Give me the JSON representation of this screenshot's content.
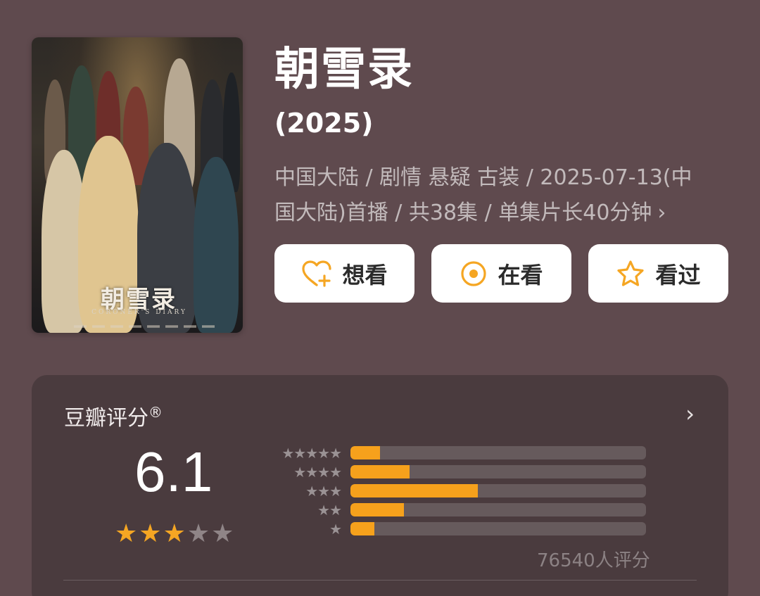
{
  "poster": {
    "logo_text": "朝雪录",
    "subtitle": "CORONER'S DIARY"
  },
  "title": "朝雪录",
  "year": "(2025)",
  "meta": {
    "line1": "中国大陆 / 剧情 悬疑 古装 / 2025-07-13(中",
    "line2": "国大陆)首播 / 共38集 / 单集片长40分钟",
    "chevron": "›"
  },
  "actions": [
    {
      "label": "想看",
      "icon": "heart-plus-icon"
    },
    {
      "label": "在看",
      "icon": "target-circle-icon"
    },
    {
      "label": "看过",
      "icon": "star-outline-icon"
    }
  ],
  "rating": {
    "title": "豆瓣评分",
    "registered_mark": "®",
    "arrow": "›",
    "score": "6.1",
    "stars_filled": 3,
    "stars_total": 5,
    "distribution": [
      {
        "stars": 5,
        "fraction": 0.1
      },
      {
        "stars": 4,
        "fraction": 0.2
      },
      {
        "stars": 3,
        "fraction": 0.43
      },
      {
        "stars": 2,
        "fraction": 0.18
      },
      {
        "stars": 1,
        "fraction": 0.08
      }
    ],
    "count_text": "76540人评分"
  },
  "colors": {
    "background": "#5f4a4e",
    "card": "#4a3b3e",
    "accent": "#f6a11c",
    "track": "#665a5c"
  }
}
